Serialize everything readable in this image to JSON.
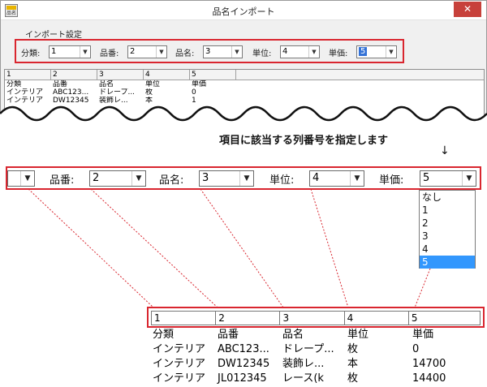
{
  "window": {
    "title": "品名インポート",
    "app_icon_text": "品名",
    "close_label": "✕"
  },
  "settings": {
    "section_label": "インポート設定",
    "fields": [
      {
        "label": "分類:",
        "value": "1"
      },
      {
        "label": "品番:",
        "value": "2"
      },
      {
        "label": "品名:",
        "value": "3"
      },
      {
        "label": "単位:",
        "value": "4"
      },
      {
        "label": "単価:",
        "value": "5"
      }
    ]
  },
  "grid": {
    "headers": [
      "1",
      "2",
      "3",
      "4",
      "5"
    ],
    "rows": [
      [
        "分類",
        "品番",
        "品名",
        "単位",
        "単価"
      ],
      [
        "インテリア",
        "ABC123...",
        "ドレープ...",
        "枚",
        "0"
      ],
      [
        "インテリア",
        "DW12345",
        "装飾レ...",
        "本",
        "1"
      ]
    ]
  },
  "instruction": "項目に該当する列番号を指定します",
  "zoom_dropdown": {
    "fields": [
      {
        "label": "品番:",
        "value": "2"
      },
      {
        "label": "品名:",
        "value": "3"
      },
      {
        "label": "単位:",
        "value": "4"
      },
      {
        "label": "単価:",
        "value": "5"
      }
    ],
    "options": [
      "なし",
      "1",
      "2",
      "3",
      "4",
      "5"
    ],
    "selected_option": "5"
  },
  "zoom_grid": {
    "headers": [
      "1",
      "2",
      "3",
      "4",
      "5"
    ],
    "rows": [
      [
        "分類",
        "品番",
        "品名",
        "単位",
        "単価"
      ],
      [
        "インテリア",
        "ABC123...",
        "ドレープ...",
        "枚",
        "0"
      ],
      [
        "インテリア",
        "DW12345",
        "装飾レ...",
        "本",
        "14700"
      ],
      [
        "インテリア",
        "JL012345",
        "レース(k",
        "枚",
        "14400"
      ]
    ]
  },
  "colors": {
    "highlight_border": "#d9262f",
    "selection": "#3297fd",
    "close_button": "#c7413b"
  }
}
